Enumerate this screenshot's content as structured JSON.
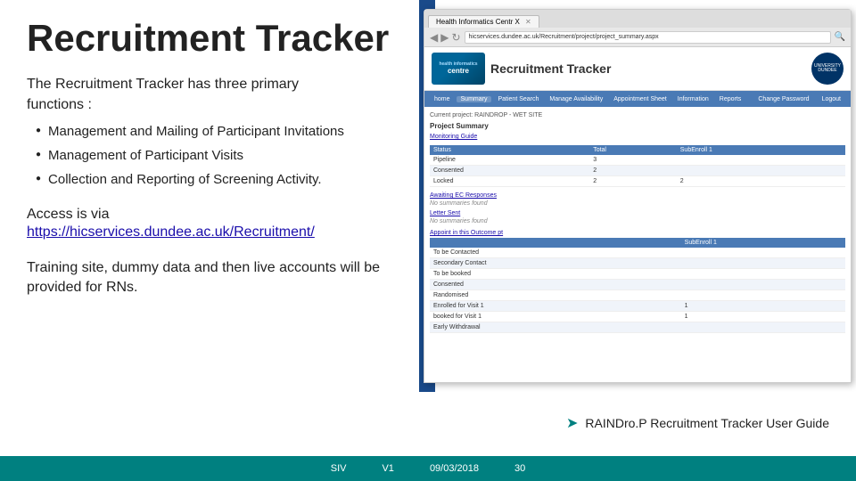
{
  "slide": {
    "title": "Recruitment Tracker",
    "intro_line1": "The Recruitment Tracker has three primary",
    "intro_line2": "functions :",
    "bullets": [
      "Management and Mailing of Participant Invitations",
      "Management of Participant Visits",
      "Collection and Reporting of Screening Activity."
    ],
    "access_label": "Access is via",
    "access_link": "https://hicservices.dundee.ac.uk/Recruitment/",
    "training_text": "Training site, dummy data and then live accounts will be provided for RNs."
  },
  "browser": {
    "tab_label": "Health Informatics Centr X",
    "address": "hicservices.dundee.ac.uk/Recruitment/project/project_summary.aspx",
    "close_btn": "✕"
  },
  "hic": {
    "logo_lines": [
      "health informatics",
      "centre"
    ],
    "tracker_title": "Recruitment Tracker",
    "nav_items": [
      "home",
      "Summary",
      "Patient Search",
      "Manage Availability",
      "Appointment Sheet",
      "Information",
      "Reports"
    ],
    "nav_right_items": [
      "Change Password",
      "Logout"
    ],
    "breadcrumb": "Current project: RAINDROP - WET SITE",
    "project_summary_title": "Project Summary",
    "monitoring_guide": "Monitoring Guide",
    "table_headers": [
      "Status",
      "Total",
      "SubEnroll 1"
    ],
    "table_rows": [
      [
        "Pipeline",
        "3",
        ""
      ],
      [
        "Consented",
        "2",
        ""
      ],
      [
        "Locked",
        "2",
        "2"
      ]
    ],
    "mailing_title": "Awaiting EC Responses",
    "mailing_value": "No summaries found",
    "letter_title": "Letter Sent",
    "letter_value": "No summaries found",
    "appoint_title": "Appoint in this Outcome pt",
    "appoint_headers": [
      "",
      "SubEnroll 1"
    ],
    "appoint_rows": [
      [
        "To be Contacted",
        ""
      ],
      [
        "Secondary Contact",
        ""
      ],
      [
        "To be booked",
        ""
      ],
      [
        "Consented",
        ""
      ],
      [
        "Randomised",
        ""
      ],
      [
        "Enrolled for Visit 1",
        "1"
      ],
      [
        "booked for Visit 1",
        "1"
      ],
      [
        "Early Withdrawal",
        ""
      ]
    ]
  },
  "raindrop": {
    "label": "RAINDro.P Recruitment Tracker User Guide"
  },
  "footer": {
    "version": "SIV",
    "v_label": "V1",
    "date": "09/03/2018",
    "page": "30"
  }
}
